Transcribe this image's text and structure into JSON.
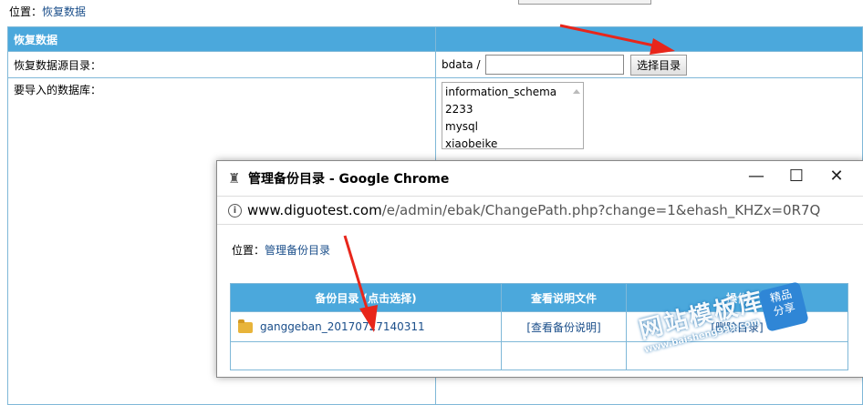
{
  "location": {
    "prefix": "位置：",
    "link": "恢复数据"
  },
  "main": {
    "header": "恢复数据",
    "source_label": "恢复数据源目录：",
    "path_prefix": "bdata /",
    "path_value": "",
    "select_dir_button": "选择目录",
    "db_label": "要导入的数据库：",
    "databases": [
      "information_schema",
      "2233",
      "mysql",
      "xiaobeike"
    ]
  },
  "popup": {
    "title": "管理备份目录 - Google Chrome",
    "url_host": "www.diguotest.com",
    "url_path": "/e/admin/ebak/ChangePath.php?change=1&ehash_KHZx=0R7Q",
    "location_prefix": "位置：",
    "location_link": "管理备份目录",
    "table": {
      "headers": [
        "备份目录 (点击选择)",
        "查看说明文件",
        "操作"
      ],
      "rows": [
        {
          "name": "ganggeban_20170727140311",
          "view": "[查看备份说明]",
          "action": "[删除目录]"
        }
      ]
    }
  },
  "watermark": {
    "main": "网站模板库",
    "url": "www.baisheng999.com",
    "badge_line1": "精品",
    "badge_line2": "分享"
  },
  "colors": {
    "header_blue": "#4ba8dc",
    "link_blue": "#1a4e8a",
    "arrow_red": "#e8261b"
  }
}
